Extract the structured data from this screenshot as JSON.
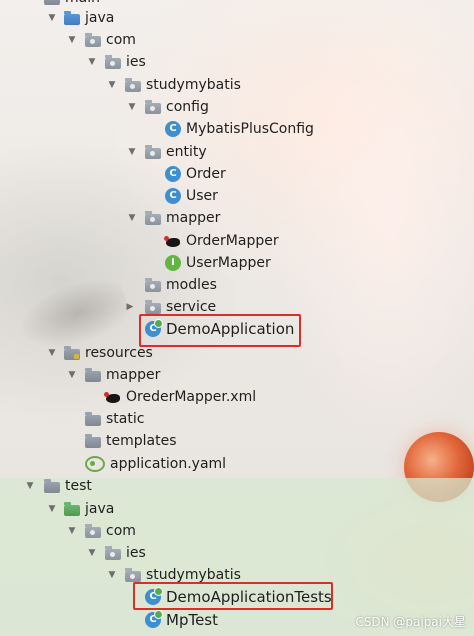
{
  "tree": {
    "main": {
      "label": "main"
    },
    "items": [
      {
        "label": "java",
        "expanded": true,
        "icon": "source-folder-icon"
      },
      {
        "label": "com",
        "expanded": true,
        "icon": "package-icon"
      },
      {
        "label": "ies",
        "expanded": true,
        "icon": "package-icon"
      },
      {
        "label": "studymybatis",
        "expanded": true,
        "icon": "package-icon"
      },
      {
        "label": "config",
        "expanded": true,
        "icon": "package-icon"
      },
      {
        "label": "MybatisPlusConfig",
        "icon": "class-icon"
      },
      {
        "label": "entity",
        "expanded": true,
        "icon": "package-icon"
      },
      {
        "label": "Order",
        "icon": "class-icon"
      },
      {
        "label": "User",
        "icon": "class-icon"
      },
      {
        "label": "mapper",
        "expanded": true,
        "icon": "package-icon"
      },
      {
        "label": "OrderMapper",
        "icon": "mybatis-icon"
      },
      {
        "label": "UserMapper",
        "icon": "interface-icon"
      },
      {
        "label": "modles",
        "icon": "package-icon"
      },
      {
        "label": "service",
        "expanded": false,
        "icon": "package-icon"
      },
      {
        "label": "DemoApplication",
        "icon": "spring-boot-class-icon"
      },
      {
        "label": "resources",
        "expanded": true,
        "icon": "resources-folder-icon"
      },
      {
        "label": "mapper",
        "expanded": true,
        "icon": "folder-icon"
      },
      {
        "label": "OrederMapper.xml",
        "icon": "mybatis-icon"
      },
      {
        "label": "static",
        "icon": "folder-icon"
      },
      {
        "label": "templates",
        "icon": "folder-icon"
      },
      {
        "label": "application.yaml",
        "icon": "yaml-icon"
      },
      {
        "label": "test",
        "expanded": true,
        "icon": "folder-icon"
      },
      {
        "label": "java",
        "expanded": true,
        "icon": "test-source-folder-icon"
      },
      {
        "label": "com",
        "expanded": true,
        "icon": "package-icon"
      },
      {
        "label": "ies",
        "expanded": true,
        "icon": "package-icon"
      },
      {
        "label": "studymybatis",
        "expanded": true,
        "icon": "package-icon"
      },
      {
        "label": "DemoApplicationTests",
        "icon": "spring-boot-test-class-icon"
      },
      {
        "label": "MpTest",
        "icon": "spring-boot-test-class-icon"
      }
    ]
  },
  "class_letter": "C",
  "interface_letter": "I",
  "arrows": {
    "expanded": "▼",
    "collapsed": "▶"
  },
  "watermark": "CSDN @paipai大星",
  "colors": {
    "highlight_border": "#d93025",
    "class_icon": "#3d8fd1",
    "interface_icon": "#62b543",
    "test_band": "#d7e8d0"
  }
}
